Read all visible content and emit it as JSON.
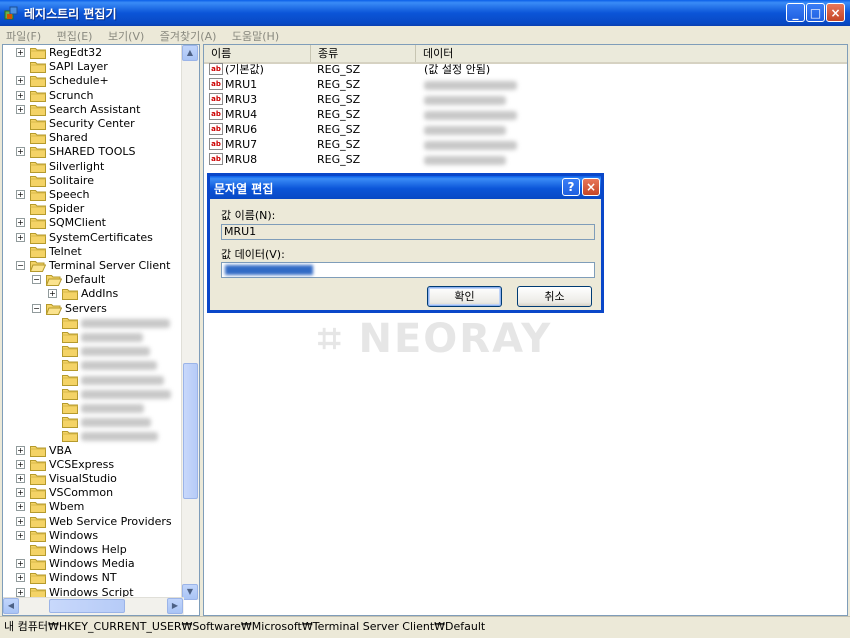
{
  "window": {
    "title": "레지스트리 편집기",
    "min_glyph": "_",
    "max_glyph": "□",
    "close_glyph": "×"
  },
  "menu": [
    "파일(F)",
    "편집(E)",
    "보기(V)",
    "즐겨찾기(A)",
    "도움말(H)"
  ],
  "tree": {
    "items": [
      {
        "label": "RegEdt32",
        "expander": "+",
        "level": 0
      },
      {
        "label": "SAPI Layer",
        "expander": "",
        "level": 0
      },
      {
        "label": "Schedule+",
        "expander": "+",
        "level": 0
      },
      {
        "label": "Scrunch",
        "expander": "+",
        "level": 0
      },
      {
        "label": "Search Assistant",
        "expander": "+",
        "level": 0
      },
      {
        "label": "Security Center",
        "expander": "",
        "level": 0
      },
      {
        "label": "Shared",
        "expander": "",
        "level": 0
      },
      {
        "label": "SHARED TOOLS",
        "expander": "+",
        "level": 0
      },
      {
        "label": "Silverlight",
        "expander": "",
        "level": 0
      },
      {
        "label": "Solitaire",
        "expander": "",
        "level": 0
      },
      {
        "label": "Speech",
        "expander": "+",
        "level": 0
      },
      {
        "label": "Spider",
        "expander": "",
        "level": 0
      },
      {
        "label": "SQMClient",
        "expander": "+",
        "level": 0
      },
      {
        "label": "SystemCertificates",
        "expander": "+",
        "level": 0
      },
      {
        "label": "Telnet",
        "expander": "",
        "level": 0
      },
      {
        "label": "Terminal Server Client",
        "expander": "−",
        "level": 0
      },
      {
        "label": "Default",
        "expander": "−",
        "level": 1
      },
      {
        "label": "AddIns",
        "expander": "+",
        "level": 2
      },
      {
        "label": "Servers",
        "expander": "−",
        "level": 1
      },
      {
        "label": "",
        "expander": "",
        "level": 2
      },
      {
        "label": "",
        "expander": "",
        "level": 2
      },
      {
        "label": "",
        "expander": "",
        "level": 2
      },
      {
        "label": "",
        "expander": "",
        "level": 2
      },
      {
        "label": "",
        "expander": "",
        "level": 2
      },
      {
        "label": "",
        "expander": "",
        "level": 2
      },
      {
        "label": "",
        "expander": "",
        "level": 2
      },
      {
        "label": "",
        "expander": "",
        "level": 2
      },
      {
        "label": "",
        "expander": "",
        "level": 2
      },
      {
        "label": "VBA",
        "expander": "+",
        "level": 0
      },
      {
        "label": "VCSExpress",
        "expander": "+",
        "level": 0
      },
      {
        "label": "VisualStudio",
        "expander": "+",
        "level": 0
      },
      {
        "label": "VSCommon",
        "expander": "+",
        "level": 0
      },
      {
        "label": "Wbem",
        "expander": "+",
        "level": 0
      },
      {
        "label": "Web Service Providers",
        "expander": "+",
        "level": 0
      },
      {
        "label": "Windows",
        "expander": "+",
        "level": 0
      },
      {
        "label": "Windows Help",
        "expander": "",
        "level": 0
      },
      {
        "label": "Windows Media",
        "expander": "+",
        "level": 0
      },
      {
        "label": "Windows NT",
        "expander": "+",
        "level": 0
      },
      {
        "label": "Windows Script",
        "expander": "+",
        "level": 0
      }
    ]
  },
  "list": {
    "columns": [
      "이름",
      "종류",
      "데이터"
    ],
    "rows": [
      {
        "name": "(기본값)",
        "type": "REG_SZ",
        "data": "(값 설정 안됨)",
        "icon": "ab"
      },
      {
        "name": "MRU1",
        "type": "REG_SZ",
        "data": "",
        "icon": "ab"
      },
      {
        "name": "MRU3",
        "type": "REG_SZ",
        "data": "",
        "icon": "ab"
      },
      {
        "name": "MRU4",
        "type": "REG_SZ",
        "data": "",
        "icon": "ab"
      },
      {
        "name": "MRU6",
        "type": "REG_SZ",
        "data": "",
        "icon": "ab"
      },
      {
        "name": "MRU7",
        "type": "REG_SZ",
        "data": "",
        "icon": "ab"
      },
      {
        "name": "MRU8",
        "type": "REG_SZ",
        "data": "",
        "icon": "ab"
      }
    ]
  },
  "dialog": {
    "title": "문자열 편집",
    "help_glyph": "?",
    "close_glyph": "×",
    "name_label": "값 이름(N):",
    "name_value": "MRU1",
    "data_label": "값 데이터(V):",
    "ok_label": "확인",
    "cancel_label": "취소"
  },
  "watermark": "NEORAY",
  "statusbar": "내 컴퓨터₩HKEY_CURRENT_USER₩Software₩Microsoft₩Terminal Server Client₩Default",
  "colors": {
    "titlebar": "#0a55d8",
    "window_bg": "#ece9d8",
    "folder": "#f4d366",
    "selection": "#316ac5"
  }
}
